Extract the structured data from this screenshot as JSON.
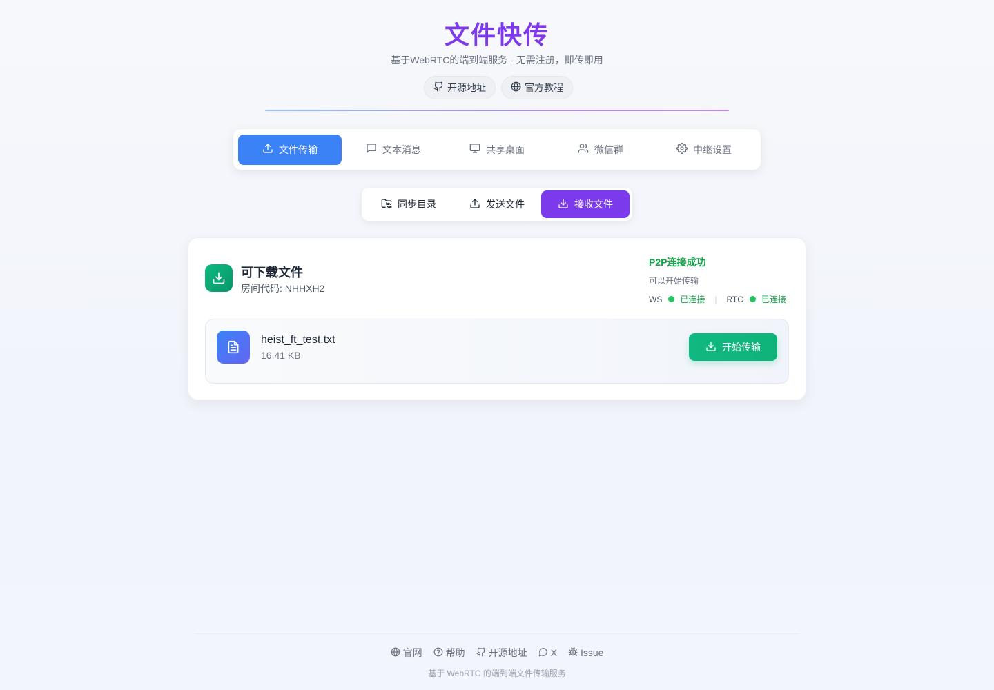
{
  "header": {
    "title": "文件快传",
    "subtitle": "基于WebRTC的端到端服务 - 无需注册，即传即用",
    "links": [
      {
        "label": "开源地址",
        "icon": "github-icon"
      },
      {
        "label": "官方教程",
        "icon": "globe-icon"
      }
    ]
  },
  "main_tabs": [
    {
      "label": "文件传输",
      "icon": "upload-icon",
      "active": true
    },
    {
      "label": "文本消息",
      "icon": "message-icon",
      "active": false
    },
    {
      "label": "共享桌面",
      "icon": "monitor-icon",
      "active": false
    },
    {
      "label": "微信群",
      "icon": "users-icon",
      "active": false
    },
    {
      "label": "中继设置",
      "icon": "gear-icon",
      "active": false
    }
  ],
  "sub_tabs": [
    {
      "label": "同步目录",
      "icon": "folder-sync-icon",
      "active": false
    },
    {
      "label": "发送文件",
      "icon": "upload-icon",
      "active": false
    },
    {
      "label": "接收文件",
      "icon": "download-icon",
      "active": true
    }
  ],
  "card": {
    "title": "可下载文件",
    "room_code": "房间代码: NHHXH2",
    "status": {
      "title": "P2P连接成功",
      "subtitle": "可以开始传输",
      "ws_label": "WS",
      "ws_state": "已连接",
      "separator": "|",
      "rtc_label": "RTC",
      "rtc_state": "已连接"
    },
    "file": {
      "name": "heist_ft_test.txt",
      "size": "16.41 KB",
      "button": "开始传输"
    }
  },
  "footer": {
    "links": [
      {
        "label": "官网",
        "icon": "globe-icon"
      },
      {
        "label": "帮助",
        "icon": "help-circle-icon"
      },
      {
        "label": "开源地址",
        "icon": "github-icon"
      },
      {
        "label": "X",
        "icon": "chat-icon"
      },
      {
        "label": "Issue",
        "icon": "bug-icon"
      }
    ],
    "note": "基于 WebRTC 的端到端文件传输服务"
  },
  "colors": {
    "primary_blue": "#3b82f6",
    "purple": "#7c3aed",
    "success_green": "#10b981"
  }
}
